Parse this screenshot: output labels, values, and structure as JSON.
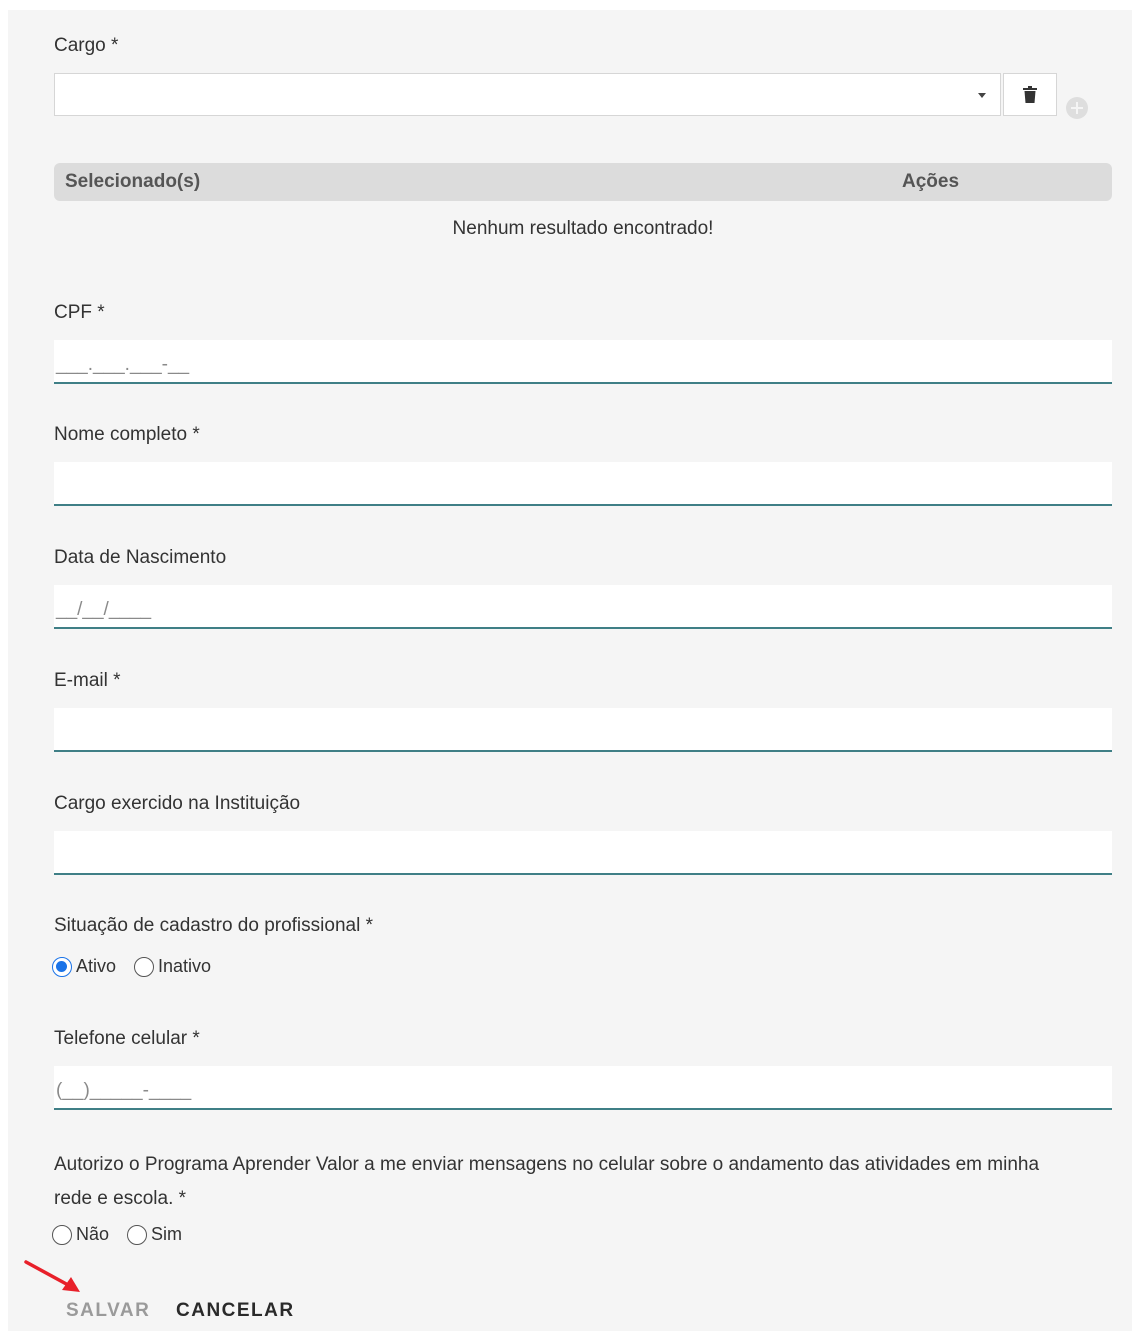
{
  "cargo": {
    "label": "Cargo *",
    "selected_value": "",
    "icons": {
      "dropdown": "caret-down-icon",
      "delete": "trash-icon",
      "add": "plus-circle-icon"
    }
  },
  "table": {
    "col_selected": "Selecionado(s)",
    "col_actions": "Ações",
    "empty_message": "Nenhum resultado encontrado!"
  },
  "cpf": {
    "label": "CPF *",
    "placeholder": "___.___.___-__"
  },
  "nome": {
    "label": "Nome completo *",
    "value": ""
  },
  "nascimento": {
    "label": "Data de Nascimento",
    "placeholder": "__/__/____"
  },
  "email": {
    "label": "E-mail *",
    "value": ""
  },
  "cargo_exercido": {
    "label": "Cargo exercido na Instituição",
    "value": ""
  },
  "situacao": {
    "label": "Situação de cadastro do profissional *",
    "options": [
      "Ativo",
      "Inativo"
    ],
    "selected": "Ativo"
  },
  "telefone": {
    "label": "Telefone celular *",
    "placeholder": "(__)_____-____"
  },
  "autorizacao": {
    "text": "Autorizo o Programa Aprender Valor a me enviar mensagens no celular sobre o andamento das atividades em minha rede e escola. *",
    "options": [
      "Não",
      "Sim"
    ],
    "selected": ""
  },
  "actions": {
    "save_label": "SALVAR",
    "cancel_label": "CANCELAR"
  },
  "colors": {
    "field_underline": "#3f7f86",
    "radio_selected": "#1a73e8",
    "annotation_arrow": "#e8202a"
  }
}
